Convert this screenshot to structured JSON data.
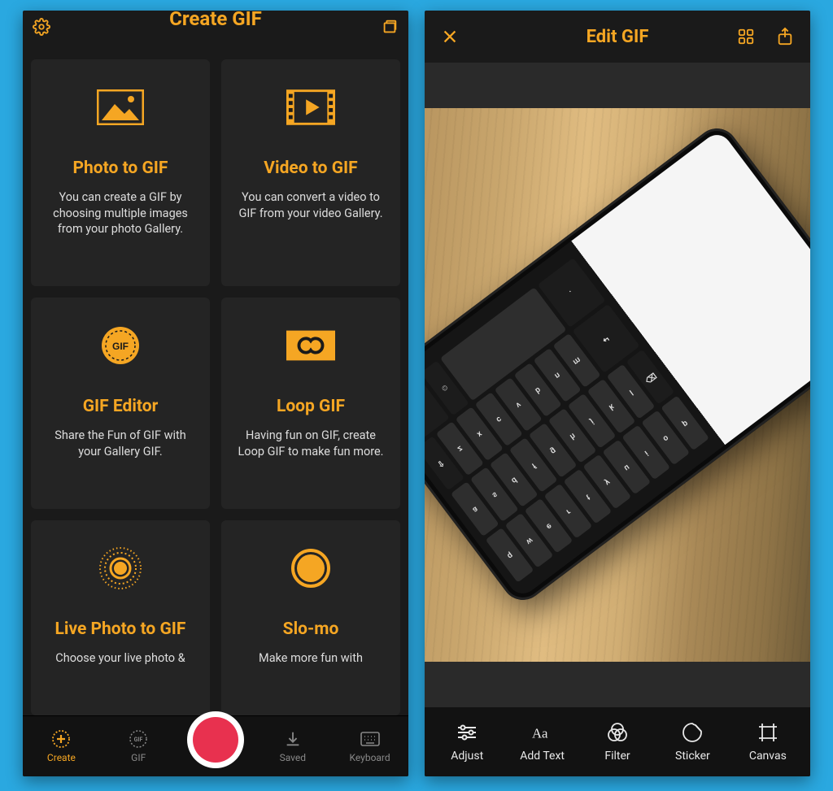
{
  "colors": {
    "accent": "#f5a623",
    "bg": "#1a1a1a",
    "card": "#242424",
    "record": "#e8314f"
  },
  "left": {
    "title": "Create GIF",
    "cards": [
      {
        "icon": "photo",
        "title": "Photo to GIF",
        "desc": "You can create a GIF by choosing multiple images from your photo Gallery."
      },
      {
        "icon": "video",
        "title": "Video to GIF",
        "desc": "You can convert a video to GIF from your video Gallery."
      },
      {
        "icon": "gif-badge",
        "title": "GIF Editor",
        "desc": "Share the Fun of GIF with your Gallery GIF."
      },
      {
        "icon": "loop",
        "title": "Loop GIF",
        "desc": "Having fun on GIF, create Loop GIF to make fun more."
      },
      {
        "icon": "live",
        "title": "Live Photo to GIF",
        "desc": "Choose your live photo &"
      },
      {
        "icon": "slomo",
        "title": "Slo-mo",
        "desc": "Make more fun with"
      }
    ],
    "tabs": [
      {
        "label": "Create",
        "icon": "create",
        "active": true
      },
      {
        "label": "GIF",
        "icon": "gif",
        "active": false
      },
      {
        "label": "Saved",
        "icon": "saved",
        "active": false
      },
      {
        "label": "Keyboard",
        "icon": "keyboard",
        "active": false
      }
    ]
  },
  "right": {
    "title": "Edit GIF",
    "tools": [
      {
        "label": "Adjust",
        "icon": "adjust"
      },
      {
        "label": "Add Text",
        "icon": "text"
      },
      {
        "label": "Filter",
        "icon": "filter"
      },
      {
        "label": "Sticker",
        "icon": "sticker"
      },
      {
        "label": "Canvas",
        "icon": "canvas"
      }
    ]
  }
}
